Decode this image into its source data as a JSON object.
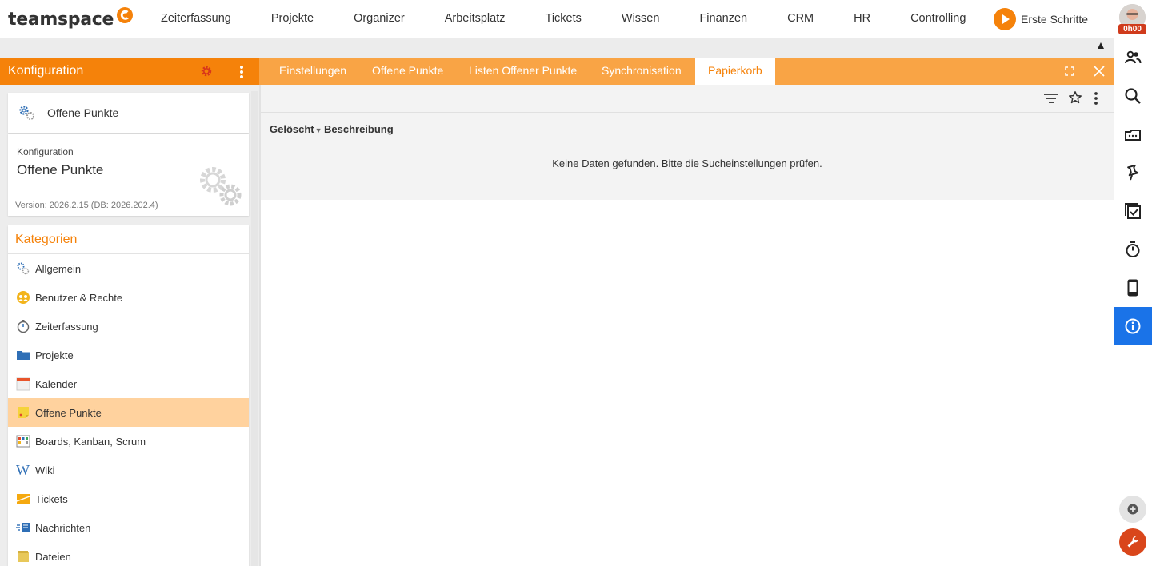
{
  "brand": {
    "name": "teamspace",
    "accent": "#f5820a",
    "tab_bg": "#f9a445",
    "active_blue": "#1a73e8"
  },
  "topnav": {
    "items": [
      {
        "label": "Zeiterfassung"
      },
      {
        "label": "Projekte"
      },
      {
        "label": "Organizer"
      },
      {
        "label": "Arbeitsplatz"
      },
      {
        "label": "Tickets"
      },
      {
        "label": "Wissen"
      },
      {
        "label": "Finanzen"
      },
      {
        "label": "CRM"
      },
      {
        "label": "HR"
      },
      {
        "label": "Controlling"
      }
    ],
    "first_steps": "Erste Schritte",
    "timer": "0h00"
  },
  "left_panel": {
    "title": "Konfiguration",
    "current_module": "Offene Punkte",
    "info": {
      "label": "Konfiguration",
      "module": "Offene Punkte",
      "version": "Version: 2026.2.15 (DB: 2026.202.4)"
    },
    "categories_title": "Kategorien",
    "categories": [
      {
        "label": "Allgemein",
        "icon": "gears-icon",
        "active": false
      },
      {
        "label": "Benutzer & Rechte",
        "icon": "users-icon",
        "active": false
      },
      {
        "label": "Zeiterfassung",
        "icon": "stopwatch-icon",
        "active": false
      },
      {
        "label": "Projekte",
        "icon": "folder-icon",
        "active": false
      },
      {
        "label": "Kalender",
        "icon": "calendar-icon",
        "active": false
      },
      {
        "label": "Offene Punkte",
        "icon": "sticky-note-icon",
        "active": true
      },
      {
        "label": "Boards, Kanban, Scrum",
        "icon": "board-icon",
        "active": false
      },
      {
        "label": "Wiki",
        "icon": "wiki-icon",
        "active": false
      },
      {
        "label": "Tickets",
        "icon": "ticket-icon",
        "active": false
      },
      {
        "label": "Nachrichten",
        "icon": "messages-icon",
        "active": false
      },
      {
        "label": "Dateien",
        "icon": "files-icon",
        "active": false
      }
    ]
  },
  "tabs": [
    {
      "label": "Einstellungen",
      "active": false
    },
    {
      "label": "Offene Punkte",
      "active": false
    },
    {
      "label": "Listen Offener Punkte",
      "active": false
    },
    {
      "label": "Synchronisation",
      "active": false
    },
    {
      "label": "Papierkorb",
      "active": true
    }
  ],
  "grid": {
    "columns": [
      {
        "label": "Gelöscht",
        "sort": "desc"
      },
      {
        "label": "Beschreibung"
      }
    ],
    "empty_message": "Keine Daten gefunden. Bitte die Sucheinstellungen prüfen."
  },
  "right_rail": {
    "buttons": [
      "people-icon",
      "search-icon",
      "inbox-icon",
      "pin-icon",
      "tasks-icon",
      "stopwatch-icon",
      "mobile-icon",
      "info-icon"
    ],
    "active": "info-icon"
  }
}
